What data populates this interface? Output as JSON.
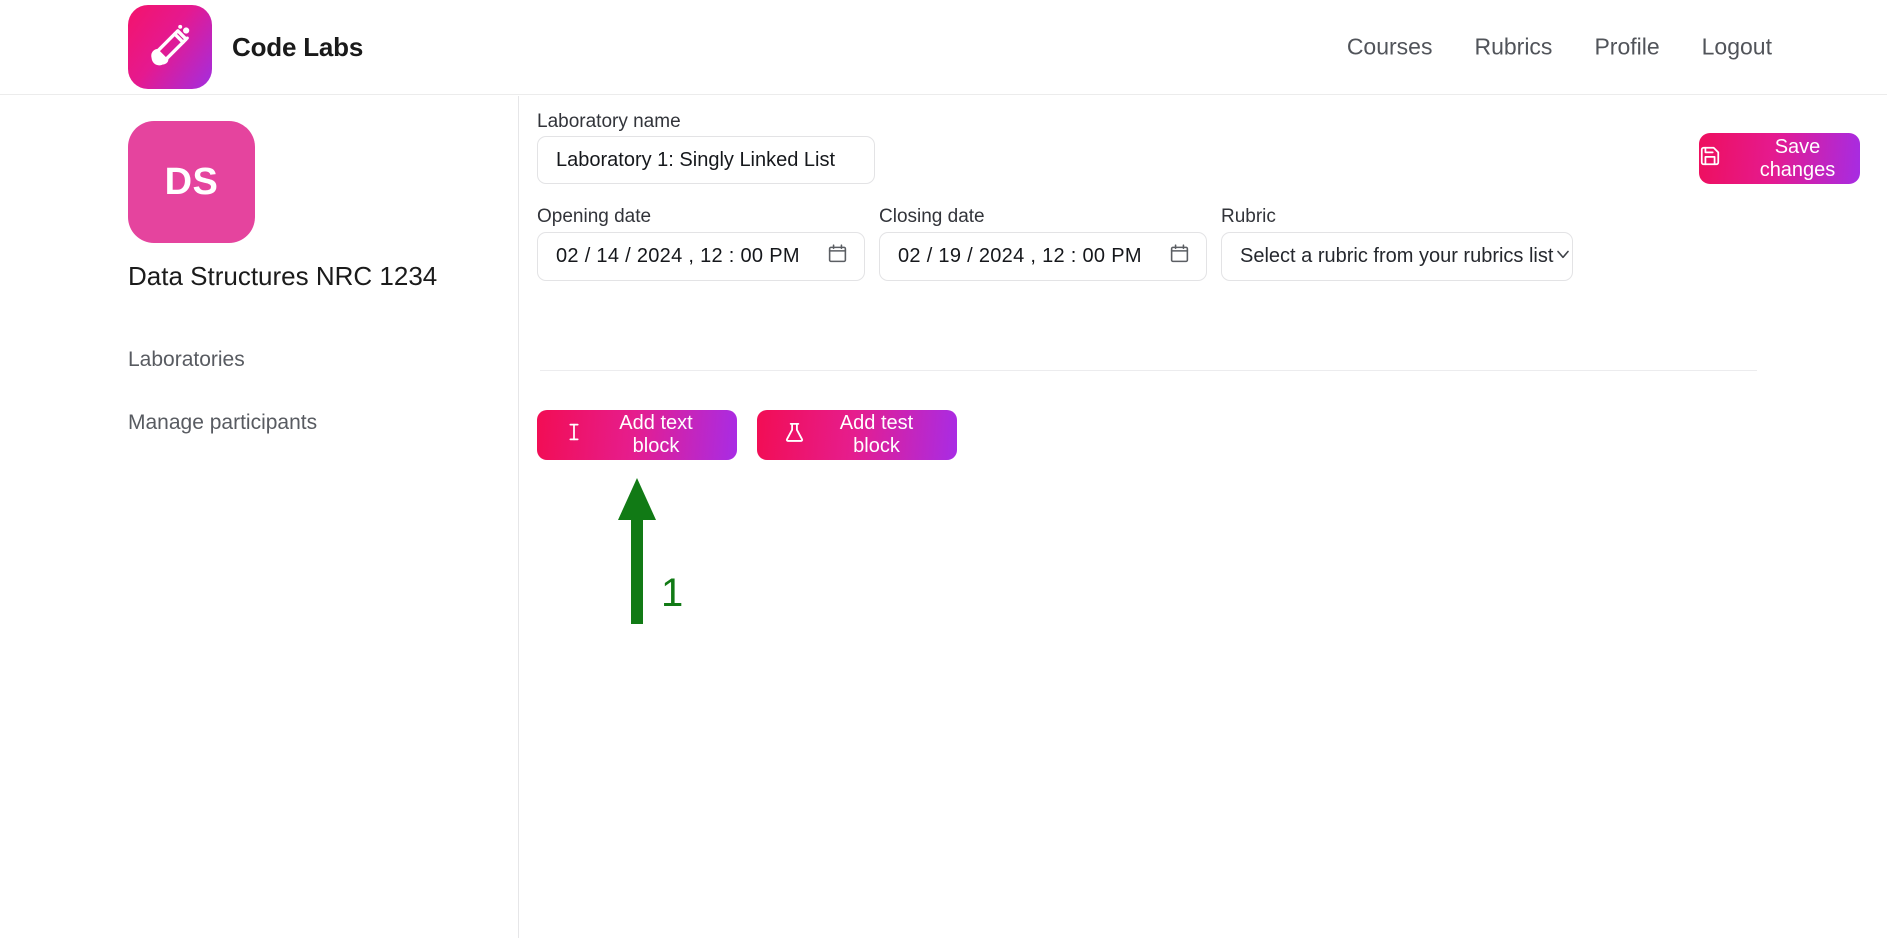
{
  "header": {
    "brand_name": "Code Labs",
    "logo_icon": "test-tube-icon",
    "nav": [
      {
        "label": "Courses"
      },
      {
        "label": "Rubrics"
      },
      {
        "label": "Profile"
      },
      {
        "label": "Logout"
      }
    ]
  },
  "sidebar": {
    "course_initials": "DS",
    "course_title": "Data Structures NRC 1234",
    "items": [
      {
        "label": "Laboratories"
      },
      {
        "label": "Manage participants"
      }
    ]
  },
  "main": {
    "lab_name": {
      "label": "Laboratory name",
      "value": "Laboratory 1: Singly Linked List",
      "placeholder": "Laboratory name"
    },
    "opening_date": {
      "label": "Opening date",
      "value": "02 / 14 / 2024 ,  12 : 00   PM",
      "icon": "calendar-icon"
    },
    "closing_date": {
      "label": "Closing date",
      "value": "02 / 19 / 2024 ,  12 : 00   PM",
      "icon": "calendar-icon"
    },
    "rubric": {
      "label": "Rubric",
      "selected": "Select a rubric from your rubrics list",
      "icon": "chevron-down-icon"
    },
    "save_button": {
      "label": "Save changes",
      "icon": "save-floppy-icon"
    },
    "actions": [
      {
        "label": "Add text block",
        "icon": "text-cursor-icon"
      },
      {
        "label": "Add test block",
        "icon": "flask-icon"
      }
    ]
  },
  "annotation": {
    "number": "1",
    "color": "#117a15",
    "points_to": "Add text block"
  }
}
